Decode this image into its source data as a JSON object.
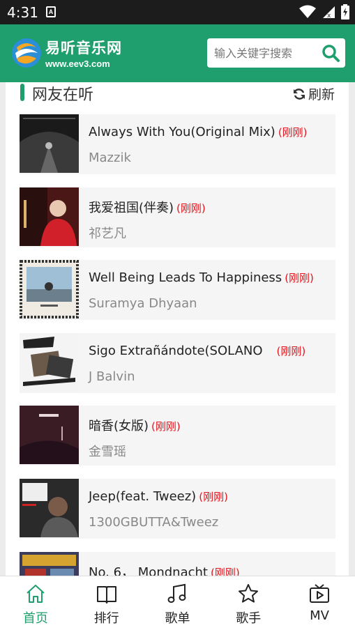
{
  "status_bar": {
    "time": "4:31",
    "notification_glyph": "A"
  },
  "header": {
    "brand": "易听音乐网",
    "url": "www.eev3.com",
    "search_placeholder": "输入关键字搜索",
    "accent_color": "#1e9f6d"
  },
  "section": {
    "title": "网友在听",
    "refresh_label": "刷新"
  },
  "songs": [
    {
      "title": "Always With You(Original Mix)",
      "tag": "(刚刚)",
      "artist": "Mazzik"
    },
    {
      "title": "我爱祖国(伴奏)",
      "tag": "(刚刚)",
      "artist": "祁艺凡"
    },
    {
      "title": "Well Being Leads To Happiness",
      "tag": "(刚刚)",
      "artist": "Suramya Dhyaan"
    },
    {
      "title": "Sigo Extrañándote(SOLANO",
      "tag": "(刚刚)",
      "artist": "J Balvin"
    },
    {
      "title": "暗香(女版)",
      "tag": "(刚刚)",
      "artist": "金雪瑶"
    },
    {
      "title": "Jeep(feat. Tweez)",
      "tag": "(刚刚)",
      "artist": "1300GBUTTA&Tweez"
    },
    {
      "title": "No. 6， Mondnacht",
      "tag": "(刚刚)",
      "artist": ""
    }
  ],
  "nav": [
    {
      "label": "首页",
      "icon": "home-icon",
      "active": true
    },
    {
      "label": "排行",
      "icon": "book-icon",
      "active": false
    },
    {
      "label": "歌单",
      "icon": "music-note-icon",
      "active": false
    },
    {
      "label": "歌手",
      "icon": "star-icon",
      "active": false
    },
    {
      "label": "MV",
      "icon": "tv-icon",
      "active": false
    }
  ]
}
